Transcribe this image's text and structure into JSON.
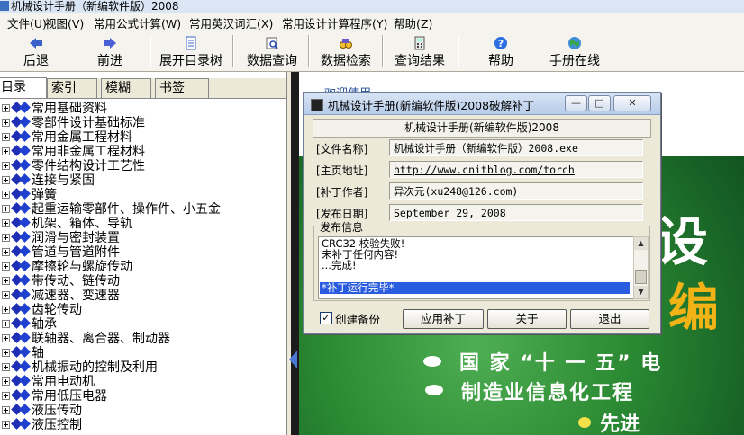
{
  "window": {
    "title": "机械设计手册（新编软件版）2008"
  },
  "menu": [
    "文件(U)",
    "视图(V)",
    "常用公式计算(W)",
    "常用英汉词汇(X)",
    "常用设计计算程序(Y)",
    "帮助(Z)"
  ],
  "toolbar": {
    "back": "后退",
    "forward": "前进",
    "expand_tree": "展开目录树",
    "data_query": "数据查询",
    "data_retrieve": "数据检索",
    "query_results": "查询结果",
    "help": "帮助",
    "online": "手册在线"
  },
  "tabs": [
    "目录",
    "索引",
    "模糊",
    "书签"
  ],
  "tree": [
    "常用基础资料",
    "零部件设计基础标准",
    "常用金属工程材料",
    "常用非金属工程材料",
    "零件结构设计工艺性",
    "连接与紧固",
    "弹簧",
    "起重运输零部件、操作件、小五金",
    "机架、箱体、导轨",
    "润滑与密封装置",
    "管道与管道附件",
    "摩擦轮与螺旋传动",
    "带传动、链传动",
    "减速器、变速器",
    "齿轮传动",
    "轴承",
    "联轴器、离合器、制动器",
    "轴",
    "机械振动的控制及利用",
    "常用电动机",
    "常用低压电器",
    "液压传动",
    "液压控制"
  ],
  "welcome": {
    "link": "欢迎使用"
  },
  "background": {
    "big_char": "设",
    "orange_char": "编",
    "slogans": [
      "国 家 “十 一 五” 电",
      "制造业信息化工程"
    ],
    "slogan_yellow": "先进"
  },
  "dialog": {
    "title": "机械设计手册(新编软件版)2008破解补丁",
    "header": "机械设计手册(新编软件版)2008",
    "fields": {
      "file_label": "[文件名称]",
      "file_value": "机械设计手册（新编软件版）2008.exe",
      "home_label": "[主页地址]",
      "home_value": "http://www.cnitblog.com/torch",
      "author_label": "[补丁作者]",
      "author_value": "异次元(xu248@126.com)",
      "date_label": "[发布日期]",
      "date_value": "September 29, 2008"
    },
    "info_label": "发布信息",
    "log": [
      "CRC32 校验失败!",
      "未补丁任何内容!",
      "...完成!",
      "",
      "*补丁运行完毕*"
    ],
    "backup_label": "创建备份",
    "backup_checked": "✓",
    "buttons": {
      "apply": "应用补丁",
      "about": "关于",
      "exit": "退出"
    },
    "window_buttons": {
      "min": "—",
      "max": "□",
      "close": "✕"
    }
  },
  "colors": {
    "tree_diamond": "#1f2fb5",
    "selection": "#2a5ce0",
    "bg_green": "#2b8a33",
    "accent_orange": "#f2b316"
  }
}
